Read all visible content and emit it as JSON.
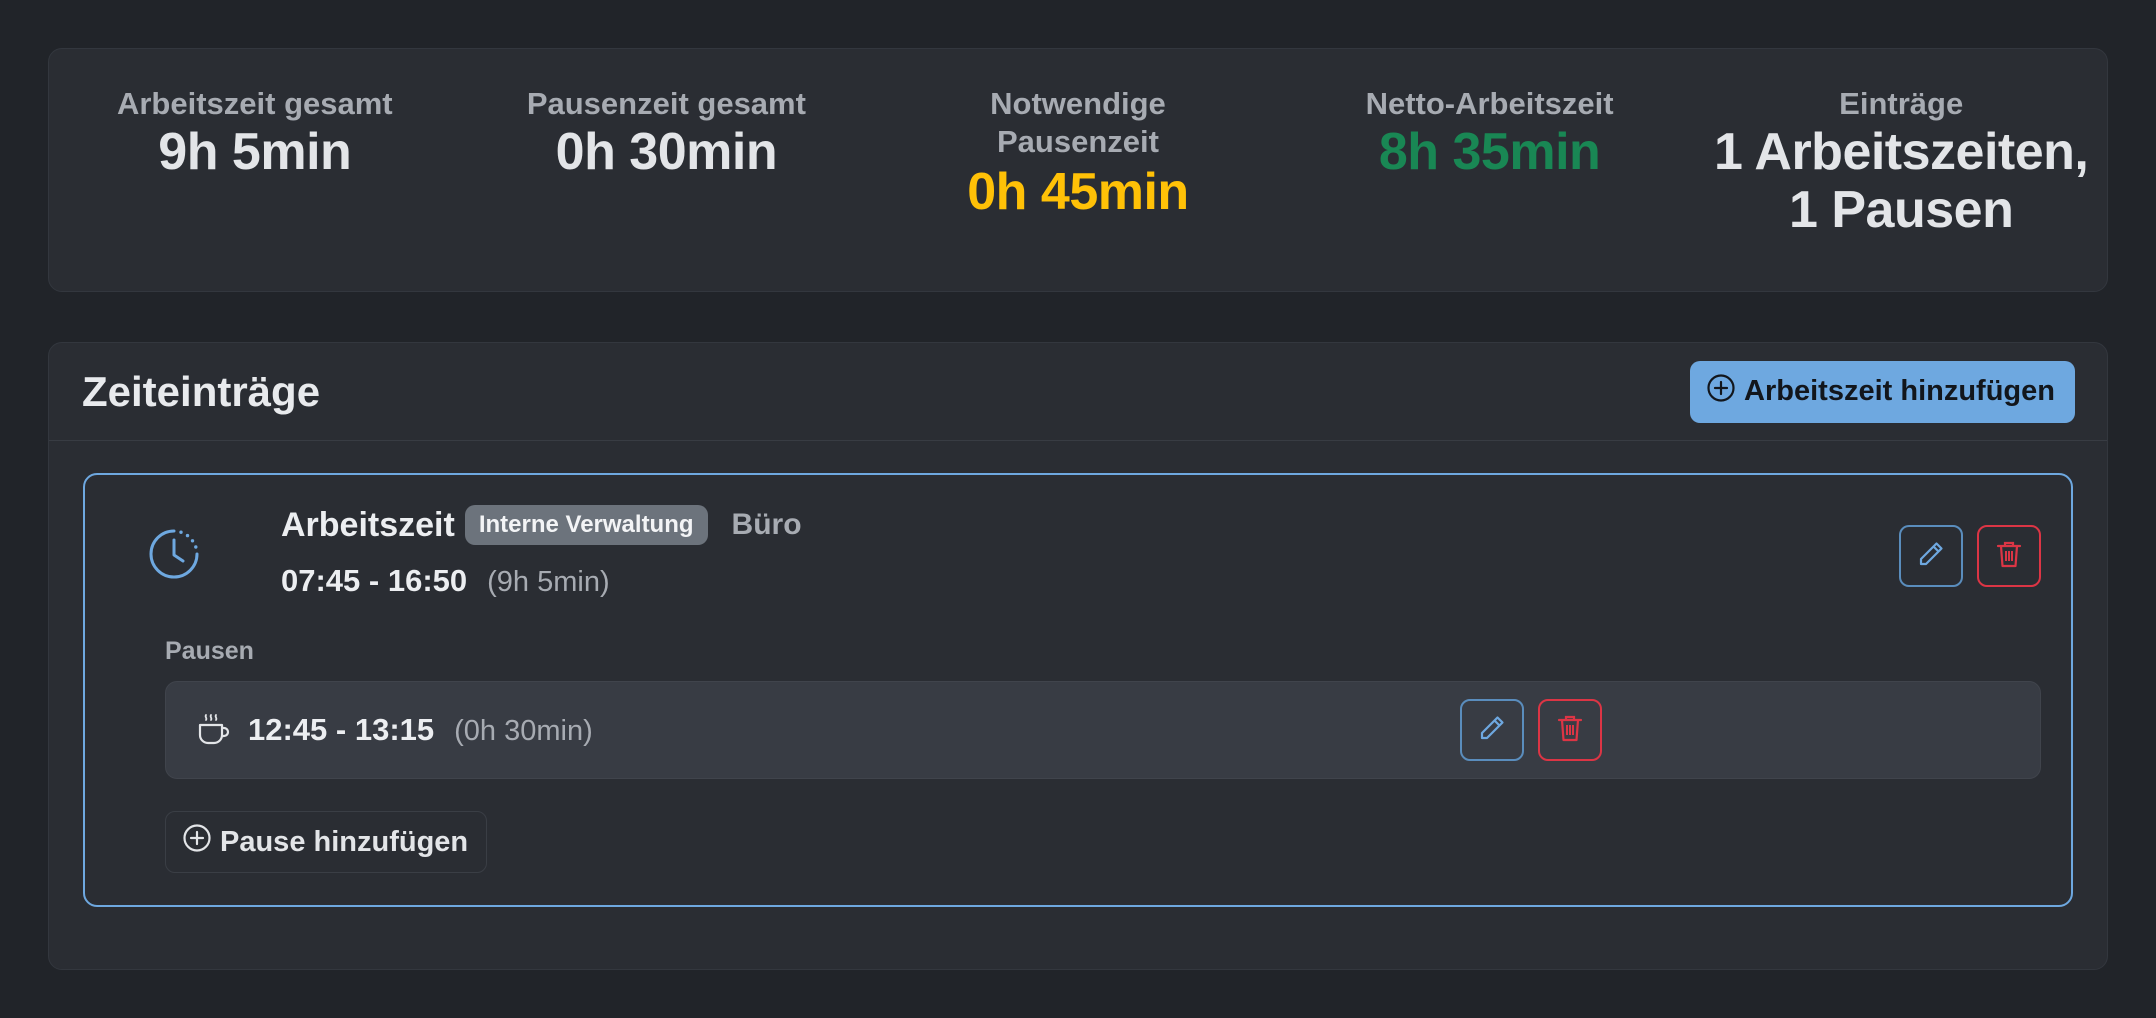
{
  "summary": {
    "total_work": {
      "label": "Arbeitszeit gesamt",
      "value": "9h 5min"
    },
    "total_break": {
      "label": "Pausenzeit gesamt",
      "value": "0h 30min"
    },
    "required_break": {
      "label_line1": "Notwendige",
      "label_line2": "Pausenzeit",
      "value": "0h 45min",
      "color": "#ffc107"
    },
    "net_work": {
      "label": "Netto-Arbeitszeit",
      "value": "8h 35min",
      "color": "#198754"
    },
    "entries": {
      "label": "Einträge",
      "value_line1": "1 Arbeitszeiten,",
      "value_line2": "1 Pausen"
    }
  },
  "time_entries": {
    "title": "Zeiteinträge",
    "add_work_label": "Arbeitszeit hinzufügen",
    "add_work_icon": "plus-circle-icon",
    "accent_color": "#6ea8e0",
    "entry": {
      "icon": "clock-icon",
      "type": "Arbeitszeit",
      "badge": "Interne Verwaltung",
      "location": "Büro",
      "time_range": "07:45 - 16:50",
      "duration": "(9h 5min)",
      "breaks_label": "Pausen",
      "breaks": [
        {
          "icon": "coffee-cup-icon",
          "time_range": "12:45 - 13:15",
          "duration": "(0h 30min)"
        }
      ],
      "add_break_label": "Pause hinzufügen"
    }
  }
}
